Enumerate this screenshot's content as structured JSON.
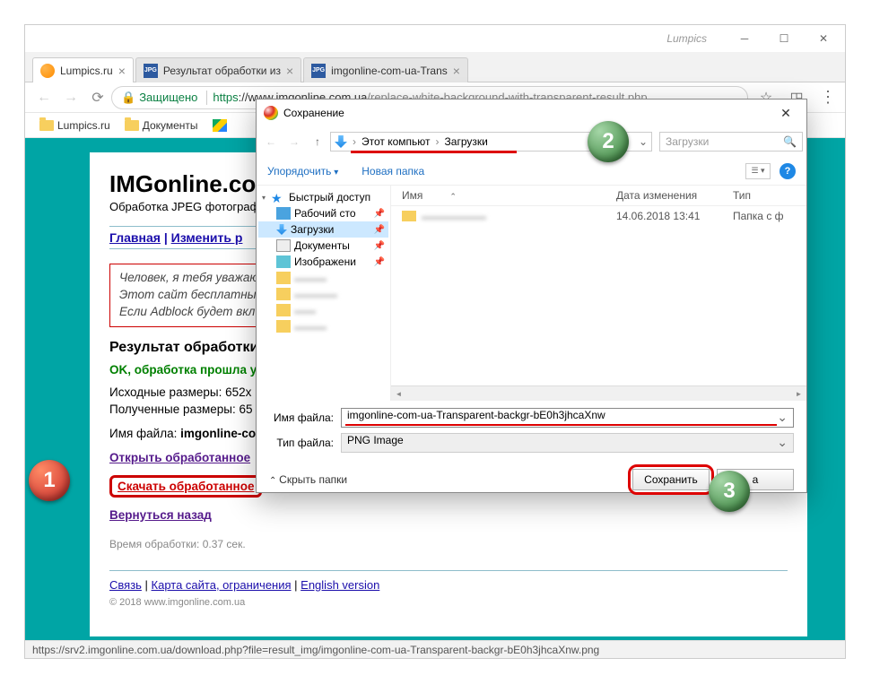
{
  "window": {
    "title": "Lumpics"
  },
  "tabs": [
    {
      "title": "Lumpics.ru",
      "icon": "orange"
    },
    {
      "title": "Результат обработки из",
      "icon": "jpg"
    },
    {
      "title": "imgonline-com-ua-Trans",
      "icon": "jpg"
    }
  ],
  "addr": {
    "secure": "Защищено",
    "protocol": "https",
    "host": "://www.imgonline.com.ua",
    "path": "/replace-white-background-with-transparent-result.php"
  },
  "bookmarks": [
    {
      "label": "Lumpics.ru",
      "type": "folder"
    },
    {
      "label": "Документы",
      "type": "folder"
    },
    {
      "label": "",
      "type": "drive"
    }
  ],
  "page": {
    "title": "IMGonline.com",
    "subtitle": "Обработка JPEG фотографи",
    "nav_main": "Главная",
    "nav_resize": "Изменить р",
    "redbox_l1": "Человек, я тебя уважаю",
    "redbox_l2": "Этот сайт бесплатный, н",
    "redbox_l3": "Если Adblock будет вкл",
    "result_heading": "Результат обработки",
    "ok_text": "OK, обработка прошла у",
    "src_dims": "Исходные размеры: 652x",
    "out_dims": "Полученные размеры: 65",
    "filename_label": "Имя файла: ",
    "filename_bold": "imgonline-co",
    "open_link": "Открыть обработанное",
    "download_link": "Скачать обработанное",
    "back_link": "Вернуться назад",
    "time": "Время обработки: 0.37 сек.",
    "footer_contact": "Связь",
    "footer_map": "Карта сайта, ограничения",
    "footer_en": "English version",
    "copyright": "© 2018 www.imgonline.com.ua"
  },
  "dialog": {
    "title": "Сохранение",
    "bc_pc": "Этот компьют",
    "bc_dl": "Загрузки",
    "search_ph": "Загрузки",
    "organize": "Упорядочить",
    "new_folder": "Новая папка",
    "tree": {
      "quick": "Быстрый доступ",
      "desktop": "Рабочий сто",
      "downloads": "Загрузки",
      "documents": "Документы",
      "images": "Изображени"
    },
    "columns": {
      "name": "Имя",
      "date": "Дата изменения",
      "type": "Тип"
    },
    "row": {
      "date": "14.06.2018 13:41",
      "type": "Папка с ф"
    },
    "filename_label": "Имя файла:",
    "filename_value": "imgonline-com-ua-Transparent-backgr-bE0h3jhcaXnw",
    "filetype_label": "Тип файла:",
    "filetype_value": "PNG Image",
    "hide_folders": "Скрыть папки",
    "save": "Сохранить",
    "cancel": "а"
  },
  "status": "https://srv2.imgonline.com.ua/download.php?file=result_img/imgonline-com-ua-Transparent-backgr-bE0h3jhcaXnw.png",
  "badges": {
    "b1": "1",
    "b2": "2",
    "b3": "3"
  }
}
